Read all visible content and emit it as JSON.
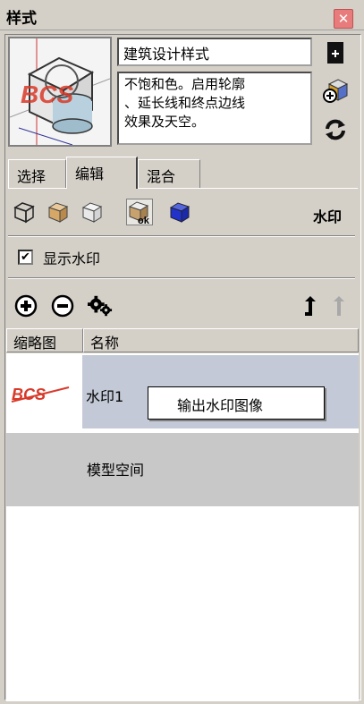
{
  "window": {
    "title": "样式"
  },
  "style": {
    "name": "建筑设计样式",
    "description": "不饱和色。启用轮廓、延长线和终点边线效果及天空。",
    "desc_lines": [
      "不饱和色。启用轮廓",
      "、延长线和终点边线",
      "效果及天空。"
    ]
  },
  "tabs": [
    {
      "label": "选择"
    },
    {
      "label": "编辑",
      "active": true
    },
    {
      "label": "混合"
    }
  ],
  "edit": {
    "section_title": "水印",
    "icons": [
      "edge-settings-icon",
      "face-settings-icon",
      "background-settings-icon",
      "watermark-settings-icon",
      "modeling-settings-icon"
    ]
  },
  "watermark": {
    "show_label": "显示水印",
    "show_checked": "✔"
  },
  "list": {
    "columns": [
      "缩略图",
      "名称"
    ],
    "rows": [
      {
        "name": "水印1",
        "thumb_text": "BCS"
      },
      {
        "name": "模型空间"
      }
    ]
  },
  "context_menu": {
    "item": "输出水印图像"
  },
  "colors": {
    "accent_red": "#d83a2a",
    "selected_row": "#c3c9d6",
    "model_row": "#c8c8c8"
  }
}
